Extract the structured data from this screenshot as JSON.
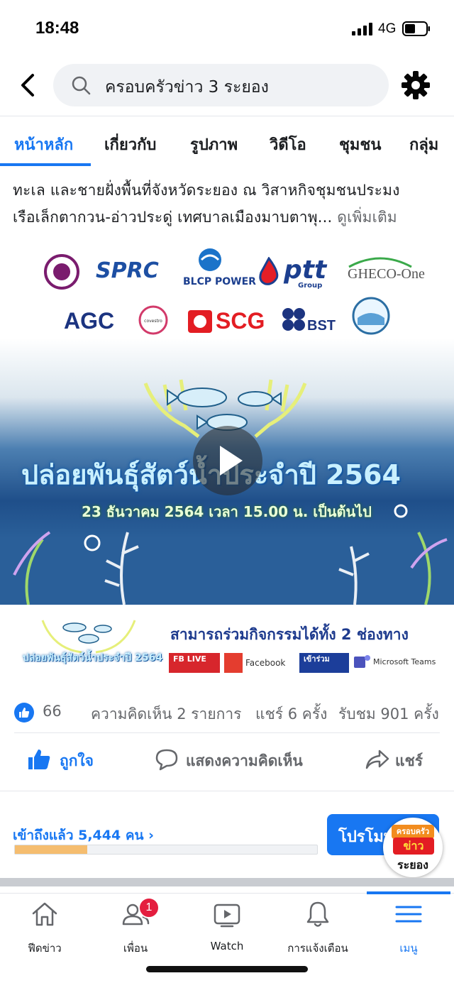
{
  "status_bar": {
    "time": "18:48",
    "network": "4G"
  },
  "search": {
    "query": "ครอบครัวข่าว 3 ระยอง"
  },
  "tabs": [
    "หน้าหลัก",
    "เกี่ยวกับ",
    "รูปภาพ",
    "วิดีโอ",
    "ชุมชน",
    "กลุ่ม"
  ],
  "post": {
    "line1": "ทะเล และชายฝั่งพื้นที่จังหวัดระยอง ณ วิสาหกิจชุมชนประมง",
    "line2": "เรือเล็กตากวน-อ่าวประดู่ เทศบาลเมืองมาบตาพุ...",
    "see_more": "ดูเพิ่มเติม"
  },
  "image": {
    "logos": {
      "sprc": "SPRC",
      "blcp": "BLCP POWER",
      "ptt": "ptt",
      "ptt_group": "Group",
      "gheco": "GHECO-One",
      "agc": "AGC",
      "covestro": "covestro",
      "scg": "SCG",
      "bst": "BST"
    },
    "title": "ปล่อยพันธุ์สัตว์น้ำประจำปี 2564",
    "subtitle": "23 ธันวาคม 2564 เวลา 15.00 น. เป็นต้นไป",
    "small_title": "ปล่อยพันธุ์สัตว์น้ำประจำปี 2564",
    "channels_title": "สามารถร่วมกิจกรรมได้ทั้ง 2 ช่องทาง",
    "fb_live": "FB LIVE",
    "facebook": "Facebook",
    "join": "เข้าร่วม",
    "teams": "Microsoft Teams"
  },
  "stats": {
    "likes": "66",
    "comments": "ความคิดเห็น 2 รายการ",
    "shares": "แชร์ 6 ครั้ง",
    "views": "รับชม 901 ครั้ง"
  },
  "actions": {
    "like": "ถูกใจ",
    "comment": "แสดงความคิดเห็น",
    "share": "แชร์"
  },
  "promo": {
    "reach": "เข้าถึงแล้ว 5,444 คน",
    "progress": 0.24,
    "button": "โปรโมท",
    "avatar_text": "ระยอง",
    "avatar_top": "ครอบครัว",
    "avatar_mid": "ข่าว"
  },
  "nav": {
    "items": [
      "ฟีดข่าว",
      "เพื่อน",
      "Watch",
      "การแจ้งเตือน",
      "เมนู"
    ],
    "friends_badge": "1"
  },
  "colors": {
    "facebook_blue": "#1877f2",
    "progress_fill": "#f5bd6f",
    "badge_red": "#e41e3f"
  }
}
